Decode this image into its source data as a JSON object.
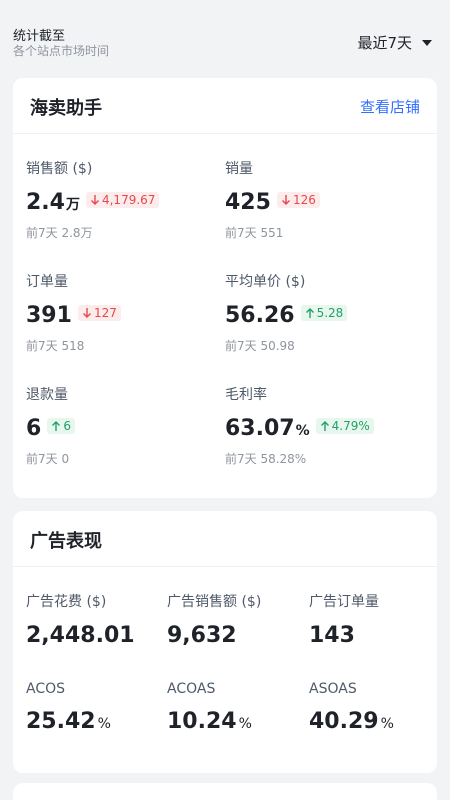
{
  "header": {
    "cutoff_label": "统计截至",
    "cutoff_sub": "各个站点市场时间",
    "range": "最近7天"
  },
  "store_card": {
    "title": "海卖助手",
    "link": "查看店铺",
    "metrics": [
      {
        "label": "销售额 ($)",
        "value": "2.4",
        "unit": "万",
        "delta": "4,179.67",
        "direction": "down",
        "prev": "前7天 2.8万"
      },
      {
        "label": "销量",
        "value": "425",
        "unit": "",
        "delta": "126",
        "direction": "down",
        "prev": "前7天 551"
      },
      {
        "label": "订单量",
        "value": "391",
        "unit": "",
        "delta": "127",
        "direction": "down",
        "prev": "前7天 518"
      },
      {
        "label": "平均单价 ($)",
        "value": "56.26",
        "unit": "",
        "delta": "5.28",
        "direction": "up",
        "prev": "前7天 50.98"
      },
      {
        "label": "退款量",
        "value": "6",
        "unit": "",
        "delta": "6",
        "direction": "up",
        "prev": "前7天 0"
      },
      {
        "label": "毛利率",
        "value": "63.07",
        "unit": "%",
        "delta": "4.79%",
        "direction": "up",
        "prev": "前7天 58.28%"
      }
    ]
  },
  "ad_card": {
    "title": "广告表现",
    "metrics": [
      {
        "label": "广告花费 ($)",
        "value": "2,448.01",
        "unit": ""
      },
      {
        "label": "广告销售额 ($)",
        "value": "9,632",
        "unit": ""
      },
      {
        "label": "广告订单量",
        "value": "143",
        "unit": ""
      },
      {
        "label": "ACOS",
        "value": "25.42",
        "unit": "%"
      },
      {
        "label": "ACOAS",
        "value": "10.24",
        "unit": "%"
      },
      {
        "label": "ASOAS",
        "value": "40.29",
        "unit": "%"
      }
    ]
  },
  "colors": {
    "accent": "#3370ff",
    "down": "#e5484d",
    "up": "#22a06b"
  }
}
